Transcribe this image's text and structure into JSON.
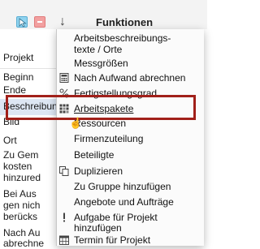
{
  "header": {
    "title": "Funktionen",
    "arrow": "↓"
  },
  "fields": [
    {
      "label": "Projekt"
    },
    {
      "label": "Beginn"
    },
    {
      "label": "Ende"
    },
    {
      "label": "Beschreibung"
    },
    {
      "label": "Bild"
    },
    {
      "label": "Ort"
    },
    {
      "label": "Zu Gem"
    },
    {
      "label": "kosten"
    },
    {
      "label": "hinzured"
    },
    {
      "label": "Bei Aus"
    },
    {
      "label": "gen nich"
    },
    {
      "label": "berücks"
    },
    {
      "label": "Nach Au"
    },
    {
      "label": "abrechne"
    }
  ],
  "menu": {
    "items": [
      {
        "line1": "Arbeitsbeschreibungs-",
        "line2": "texte / Orte"
      },
      {
        "label": "Messgrößen"
      },
      {
        "label": "Nach Aufwand abrechnen"
      },
      {
        "label": "Fertigstellungsgrad"
      },
      {
        "label": "Arbeitspakete"
      },
      {
        "label": "Ressourcen"
      },
      {
        "label": "Firmenzuteilung"
      },
      {
        "label": "Beteiligte"
      },
      {
        "label": "Duplizieren"
      },
      {
        "label": "Zu Gruppe hinzufügen"
      },
      {
        "label": "Angebote und Aufträge"
      },
      {
        "line1": "Aufgabe für Projekt",
        "line2": "hinzufügen"
      },
      {
        "label": "Termin für Projekt"
      }
    ]
  },
  "colors": {
    "highlight_border": "#a1201a",
    "cursor_tool": "#8fd3ef",
    "minus_tool": "#f2a0a0"
  }
}
